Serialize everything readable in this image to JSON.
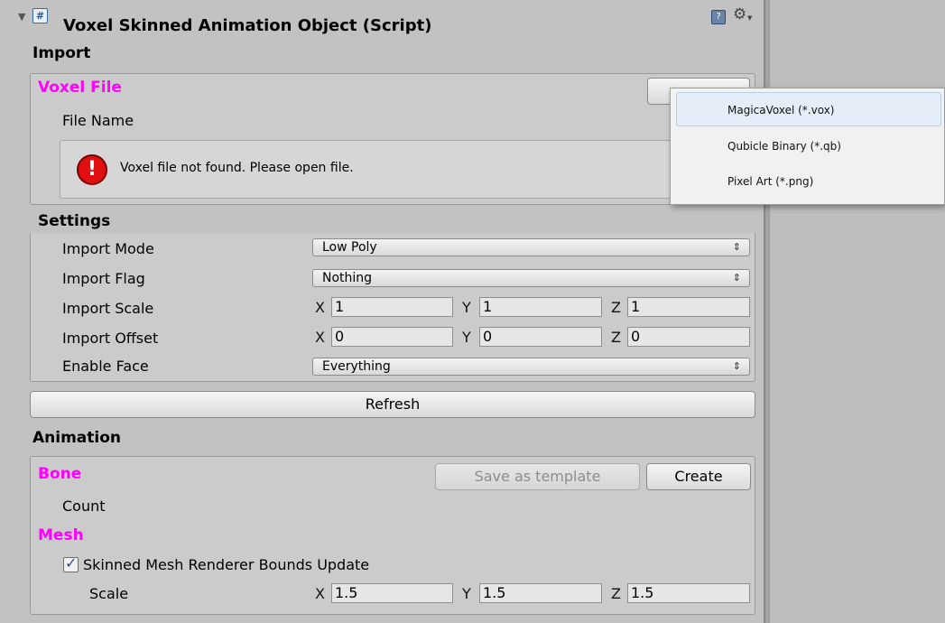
{
  "header": {
    "title": "Voxel Skinned Animation Object (Script)",
    "section_import": "Import",
    "script_icon": "cs-script-icon",
    "help_icon": "help-book-icon",
    "gear_icon": "gear-icon"
  },
  "voxel_file": {
    "label": "Voxel File",
    "file_name_label": "File Name",
    "error_message": "Voxel file not found. Please open file.",
    "error_icon": "error-icon"
  },
  "settings": {
    "label": "Settings",
    "import_mode_label": "Import Mode",
    "import_mode_value": "Low Poly",
    "import_flag_label": "Import Flag",
    "import_flag_value": "Nothing",
    "import_scale_label": "Import Scale",
    "import_scale": {
      "x": "1",
      "y": "1",
      "z": "1"
    },
    "import_offset_label": "Import Offset",
    "import_offset": {
      "x": "0",
      "y": "0",
      "z": "0"
    },
    "enable_face_label": "Enable Face",
    "enable_face_value": "Everything",
    "axis_x": "X",
    "axis_y": "Y",
    "axis_z": "Z"
  },
  "refresh_label": "Refresh",
  "animation": {
    "label": "Animation",
    "bone_label": "Bone",
    "save_template_label": "Save as template",
    "create_label": "Create",
    "count_label": "Count",
    "mesh_label": "Mesh",
    "bounds_update_label": "Skinned Mesh Renderer Bounds Update",
    "bounds_update_checked": true,
    "scale_label": "Scale",
    "scale": {
      "x": "1.5",
      "y": "1.5",
      "z": "1.5"
    }
  },
  "dropdown_menu": {
    "items": [
      {
        "label": "MagicaVoxel (*.vox)",
        "highlighted": true
      },
      {
        "label": "Qubicle Binary (*.qb)",
        "highlighted": false
      },
      {
        "label": "Pixel Art (*.png)",
        "highlighted": false
      }
    ]
  },
  "colors": {
    "section_accent": "#ff00ff",
    "panel_bg": "#c2c2c2",
    "error_red": "#e01010"
  }
}
